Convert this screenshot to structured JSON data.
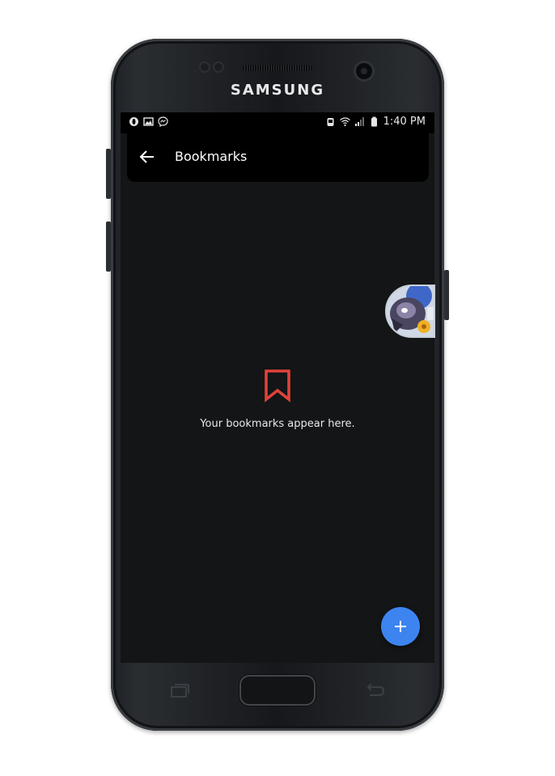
{
  "device": {
    "brand": "SAMSUNG"
  },
  "status_bar": {
    "time": "1:40 PM",
    "left_icons": [
      "opera-notification-icon",
      "image-notification-icon",
      "messenger-notification-icon"
    ],
    "right_icons": [
      "alarm-icon",
      "wifi-icon",
      "signal-icon",
      "battery-icon"
    ]
  },
  "app_bar": {
    "title": "Bookmarks",
    "back_icon": "back-arrow-icon"
  },
  "empty_state": {
    "icon": "bookmark-icon",
    "message": "Your bookmarks appear here."
  },
  "fab": {
    "icon": "plus-icon"
  },
  "colors": {
    "background": "#131516",
    "app_bar": "#000000",
    "accent_red": "#e0423a",
    "fab_blue": "#3d84f0"
  }
}
